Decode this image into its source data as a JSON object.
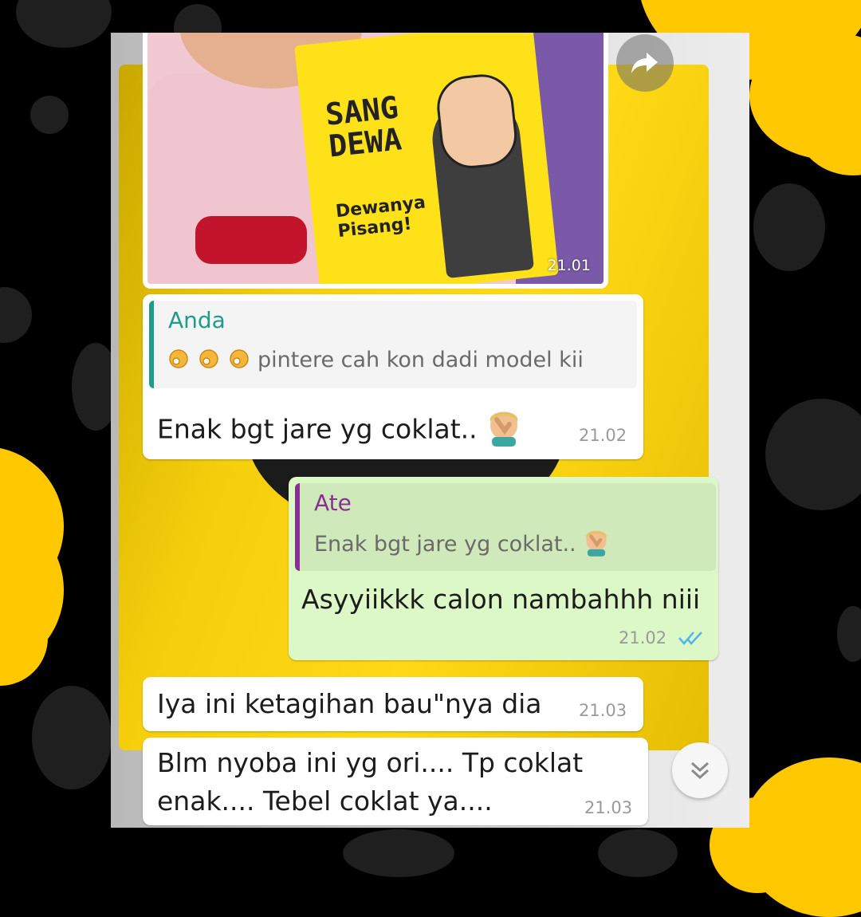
{
  "photo": {
    "time": "21.01",
    "pack_title": "SANG DEWA",
    "pack_tagline": "Dewanya Pisang!"
  },
  "messages": [
    {
      "direction": "incoming",
      "quote_author": "Anda",
      "quote_text": "pintere cah kon dadi model kii",
      "quote_emoji": "ok-hand",
      "text": "Enak bgt jare yg coklat..",
      "emoji": "facepalm",
      "time": "21.02"
    },
    {
      "direction": "outgoing",
      "quote_author": "Ate",
      "quote_text": "Enak bgt jare yg coklat..",
      "quote_emoji": "facepalm",
      "text": "Asyyiikkk calon nambahhh niii",
      "time": "21.02",
      "status": "read"
    },
    {
      "direction": "incoming",
      "text": "Iya ini ketagihan bau\"nya dia",
      "time": "21.03"
    },
    {
      "direction": "incoming",
      "text_line1": "Blm nyoba ini yg ori.... Tp coklat",
      "text_line2": "enak.... Tebel coklat ya....",
      "time": "21.03"
    }
  ],
  "colors": {
    "incoming_bubble": "#ffffff",
    "outgoing_bubble": "#dcf8c6",
    "quote_in_accent": "#1e9c8a",
    "quote_out_accent": "#8a2f93",
    "read_ticks": "#4fb6ec",
    "decor_yellow": "#ffc800"
  },
  "icons": [
    "forward-icon",
    "ok-hand-emoji",
    "facepalm-emoji",
    "double-check-icon",
    "chevron-double-down-icon"
  ]
}
